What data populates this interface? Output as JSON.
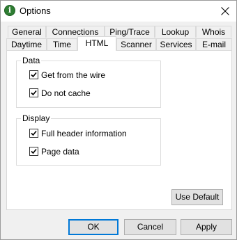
{
  "window": {
    "title": "Options"
  },
  "tabs_row1": [
    "General",
    "Connections",
    "Ping/Trace",
    "Lookup",
    "Whois"
  ],
  "tabs_row2": [
    "Daytime",
    "Time",
    "HTML",
    "Scanner",
    "Services",
    "E-mail"
  ],
  "active_tab": "HTML",
  "data_group": {
    "label": "Data",
    "options": [
      {
        "label": "Get from the wire",
        "checked": true
      },
      {
        "label": "Do not cache",
        "checked": true
      }
    ]
  },
  "display_group": {
    "label": "Display",
    "options": [
      {
        "label": "Full header information",
        "checked": true
      },
      {
        "label": "Page data",
        "checked": true
      }
    ]
  },
  "buttons": {
    "use_default": "Use Default",
    "ok": "OK",
    "cancel": "Cancel",
    "apply": "Apply"
  }
}
